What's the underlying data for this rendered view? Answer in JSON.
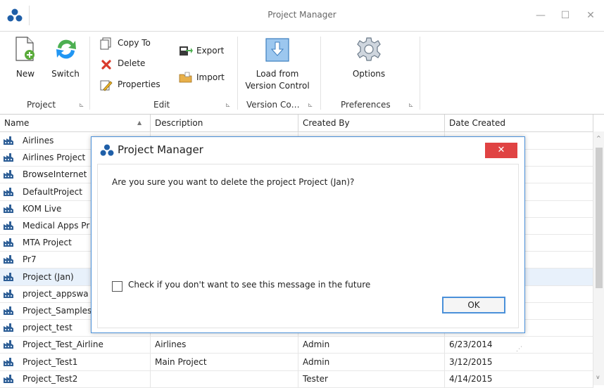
{
  "window": {
    "title": "Project Manager",
    "min": "—",
    "max": "☐",
    "close": "✕"
  },
  "ribbon": {
    "groups": [
      {
        "label": "Project",
        "launcher": "⊾"
      },
      {
        "label": "Edit",
        "launcher": "⊾"
      },
      {
        "label": "Version Co…",
        "launcher": "⊾"
      },
      {
        "label": "Preferences",
        "launcher": "⊾"
      }
    ],
    "new_label": "New",
    "switch_label": "Switch",
    "copy_to_label": "Copy To",
    "delete_label": "Delete",
    "properties_label": "Properties",
    "export_label": "Export",
    "import_label": "Import",
    "load_vc_line1": "Load from",
    "load_vc_line2": "Version Control",
    "options_label": "Options"
  },
  "grid": {
    "columns": [
      "Name",
      "Description",
      "Created By",
      "Date Created"
    ],
    "sort_indicator": "▲",
    "rows": [
      {
        "name": "Airlines",
        "description": "",
        "created_by": "",
        "date": ""
      },
      {
        "name": "Airlines Project",
        "description": "",
        "created_by": "",
        "date": ""
      },
      {
        "name": "BrowseInternet",
        "description": "",
        "created_by": "",
        "date": ""
      },
      {
        "name": "DefaultProject",
        "description": "",
        "created_by": "",
        "date": ""
      },
      {
        "name": "KOM Live",
        "description": "",
        "created_by": "",
        "date": ""
      },
      {
        "name": "Medical Apps Pr",
        "description": "",
        "created_by": "",
        "date": ""
      },
      {
        "name": "MTA Project",
        "description": "",
        "created_by": "",
        "date": ""
      },
      {
        "name": "Pr7",
        "description": "",
        "created_by": "",
        "date": ""
      },
      {
        "name": "Project (Jan)",
        "description": "",
        "created_by": "",
        "date": ""
      },
      {
        "name": "project_appswa",
        "description": "",
        "created_by": "",
        "date": ""
      },
      {
        "name": "Project_Samples",
        "description": "",
        "created_by": "",
        "date": ""
      },
      {
        "name": "project_test",
        "description": "",
        "created_by": "",
        "date": ""
      },
      {
        "name": "Project_Test_Airline",
        "description": "Airlines",
        "created_by": "Admin",
        "date": "6/23/2014"
      },
      {
        "name": "Project_Test1",
        "description": "Main Project",
        "created_by": "Admin",
        "date": "3/12/2015"
      },
      {
        "name": "Project_Test2",
        "description": "",
        "created_by": "Tester",
        "date": "4/14/2015"
      }
    ]
  },
  "dialog": {
    "title": "Project Manager",
    "close": "✕",
    "message": "Are you sure you want to delete the project Project (Jan)?",
    "checkbox_label": "Check if you don't want to see this message in the future",
    "ok_label": "OK"
  },
  "colors": {
    "accent": "#4a90d9",
    "close_red": "#e04343",
    "selected_row": "#e8f1fb"
  }
}
